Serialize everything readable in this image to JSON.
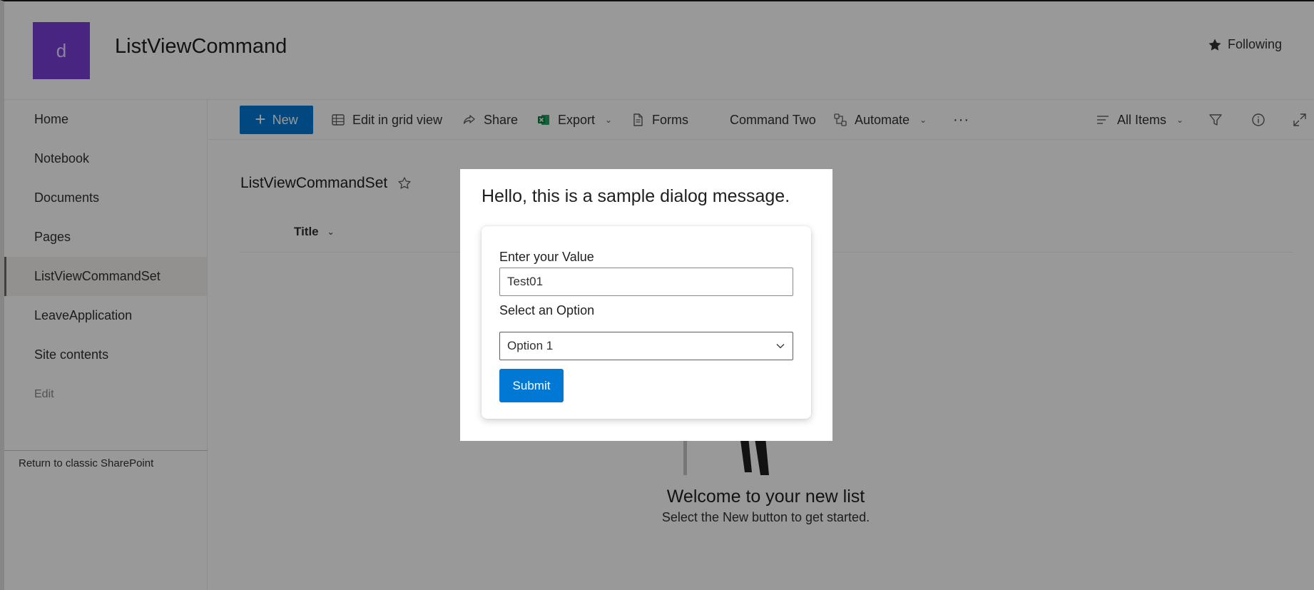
{
  "site": {
    "logo_letter": "d",
    "title": "ListViewCommand",
    "follow_label": "Following"
  },
  "nav": {
    "items": [
      {
        "label": "Home"
      },
      {
        "label": "Notebook"
      },
      {
        "label": "Documents"
      },
      {
        "label": "Pages"
      },
      {
        "label": "ListViewCommandSet",
        "active": true
      },
      {
        "label": "LeaveApplication"
      },
      {
        "label": "Site contents"
      }
    ],
    "edit_label": "Edit",
    "classic_link": "Return to classic SharePoint"
  },
  "commandbar": {
    "new_label": "New",
    "edit_grid_label": "Edit in grid view",
    "share_label": "Share",
    "export_label": "Export",
    "forms_label": "Forms",
    "command_two_label": "Command Two",
    "automate_label": "Automate",
    "more_label": "···",
    "view_label": "All Items"
  },
  "list": {
    "title": "ListViewCommandSet",
    "column_title": "Title",
    "welcome_title": "Welcome to your new list",
    "welcome_sub": "Select the New button to get started."
  },
  "dialog": {
    "message": "Hello, this is a sample dialog message.",
    "value_label": "Enter your Value",
    "value": "Test01",
    "option_label": "Select an Option",
    "selected_option": "Option 1",
    "submit_label": "Submit"
  },
  "colors": {
    "accent": "#0078d4",
    "site_logo": "#7b3fd9",
    "excel_green": "#107c41"
  }
}
